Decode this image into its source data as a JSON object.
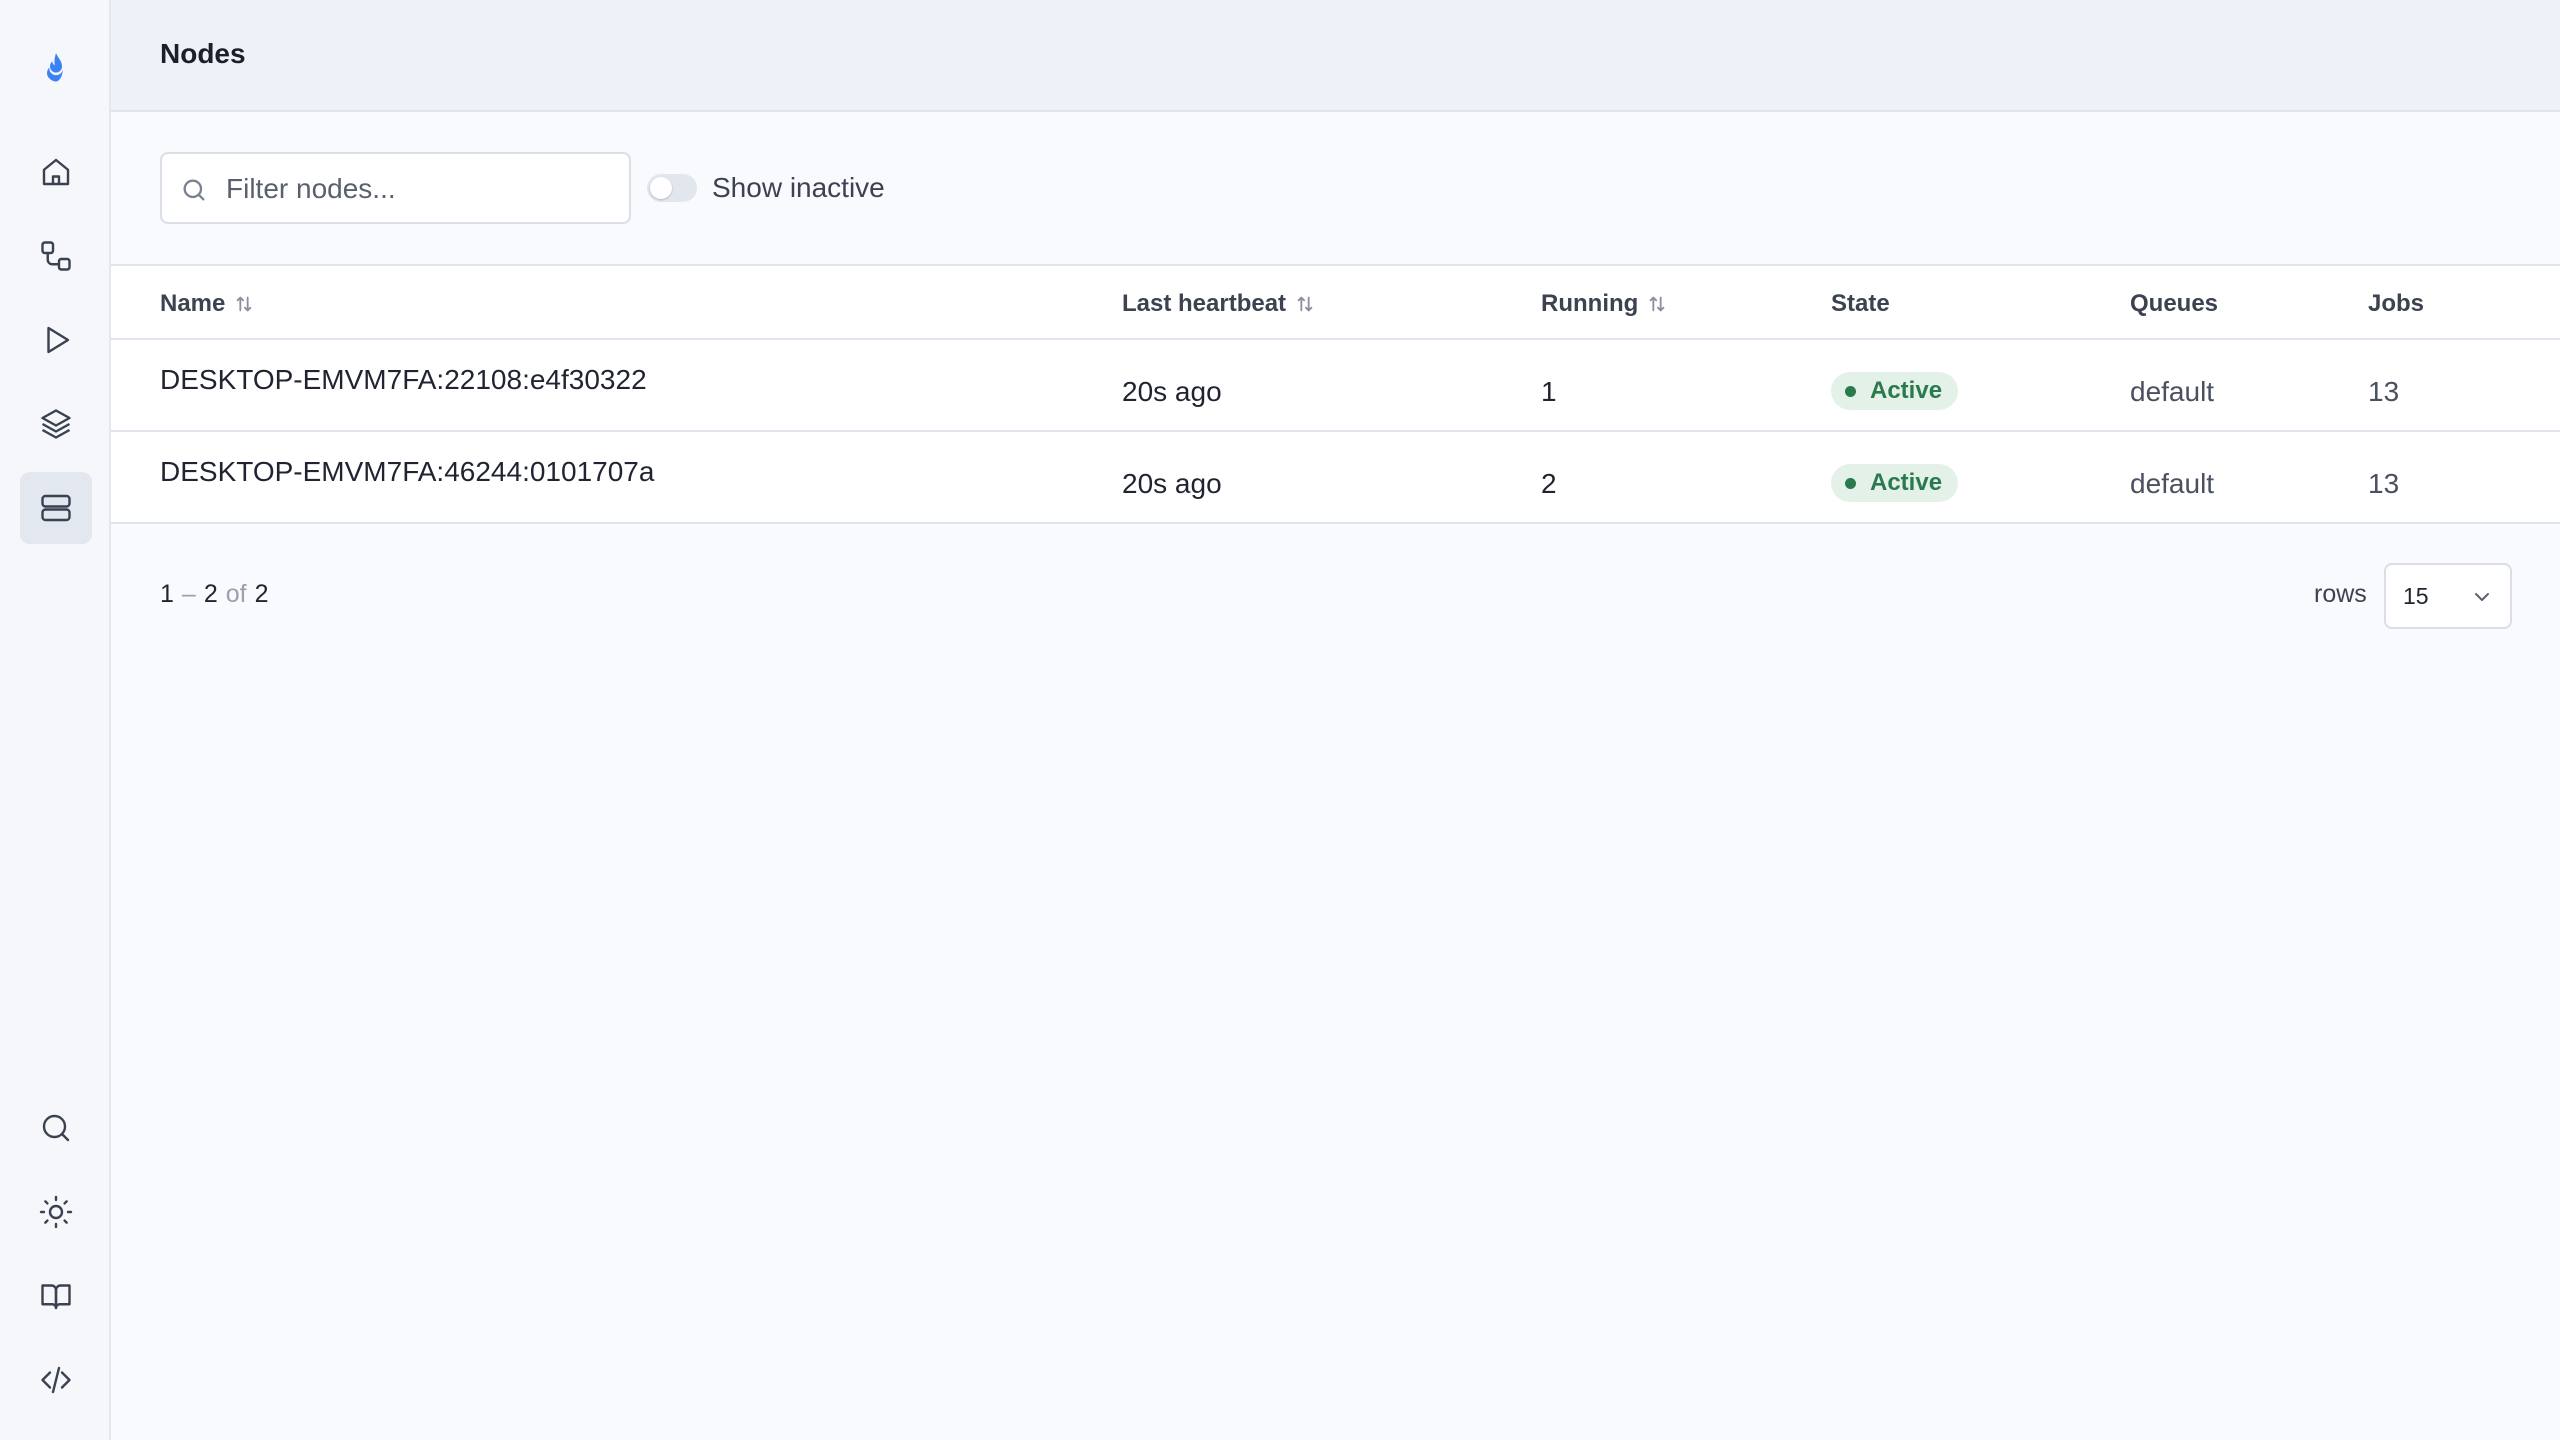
{
  "header": {
    "title": "Nodes"
  },
  "sidebar": {
    "items": [
      {
        "name": "logo",
        "icon": "flame-icon"
      },
      {
        "name": "home",
        "icon": "home-icon"
      },
      {
        "name": "workflows",
        "icon": "workflow-icon"
      },
      {
        "name": "runs",
        "icon": "play-icon"
      },
      {
        "name": "layers",
        "icon": "layers-icon"
      },
      {
        "name": "nodes",
        "icon": "server-icon",
        "active": true
      },
      {
        "name": "search",
        "icon": "search-icon"
      },
      {
        "name": "theme",
        "icon": "sun-icon"
      },
      {
        "name": "docs",
        "icon": "book-icon"
      },
      {
        "name": "api",
        "icon": "code-icon"
      }
    ]
  },
  "toolbar": {
    "search_placeholder": "Filter nodes...",
    "show_inactive_label": "Show inactive",
    "show_inactive": false
  },
  "table": {
    "columns": {
      "name": "Name",
      "last_heartbeat": "Last heartbeat",
      "running": "Running",
      "state": "State",
      "queues": "Queues",
      "jobs": "Jobs"
    },
    "rows": [
      {
        "name": "DESKTOP-EMVM7FA:22108:e4f30322",
        "last_heartbeat": "20s ago",
        "running": "1",
        "state": "Active",
        "queues": "default",
        "jobs": "13"
      },
      {
        "name": "DESKTOP-EMVM7FA:46244:0101707a",
        "last_heartbeat": "20s ago",
        "running": "2",
        "state": "Active",
        "queues": "default",
        "jobs": "13"
      }
    ]
  },
  "pagination": {
    "start": "1",
    "sep": "–",
    "end": "2",
    "of": "of",
    "total": "2",
    "rows_label": "rows",
    "rows_value": "15"
  },
  "colors": {
    "accent": "#3b82f6",
    "active_badge_bg": "#e3f1e8",
    "active_badge_fg": "#2a7a4e"
  }
}
